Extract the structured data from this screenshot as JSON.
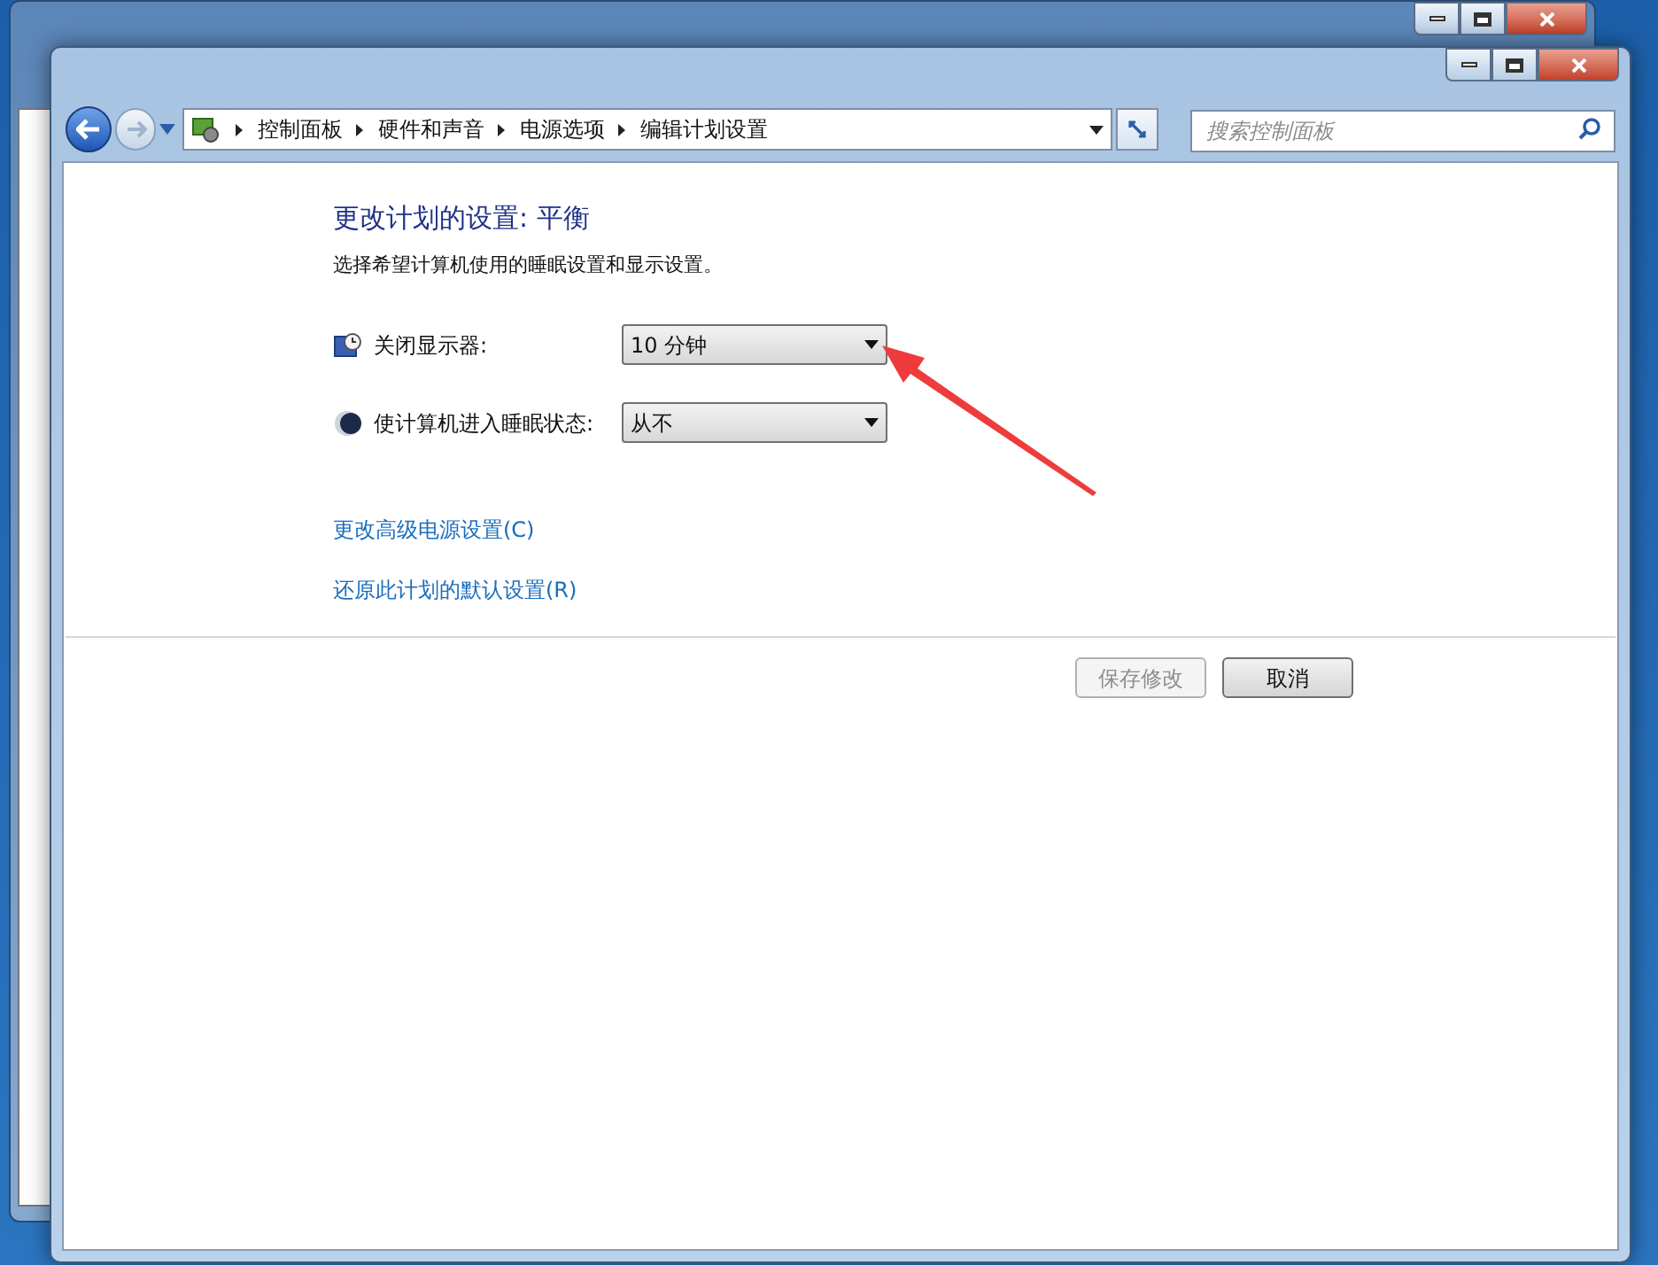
{
  "window": {
    "buttons": [
      {
        "kind": "minimize"
      },
      {
        "kind": "maximize"
      },
      {
        "kind": "close"
      }
    ]
  },
  "address_bar": {
    "breadcrumbs": [
      "控制面板",
      "硬件和声音",
      "电源选项",
      "编辑计划设置"
    ]
  },
  "search": {
    "placeholder": "搜索控制面板"
  },
  "heading": "更改计划的设置: 平衡",
  "subtitle": "选择希望计算机使用的睡眠设置和显示设置。",
  "settings": [
    {
      "kind": "display",
      "label": "关闭显示器:",
      "value": "10 分钟"
    },
    {
      "kind": "sleep",
      "label": "使计算机进入睡眠状态:",
      "value": "从不"
    }
  ],
  "links": [
    "更改高级电源设置(C)",
    "还原此计划的默认设置(R)"
  ],
  "buttons": [
    {
      "label": "保存修改",
      "disabled": true
    },
    {
      "label": "取消",
      "disabled": false
    }
  ]
}
